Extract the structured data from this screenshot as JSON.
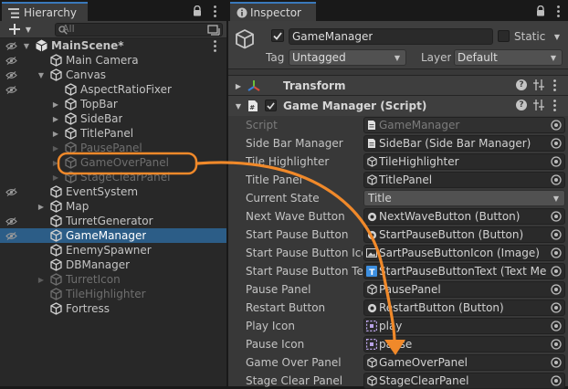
{
  "hierarchy": {
    "tab_title": "Hierarchy",
    "search_placeholder": "All",
    "items": [
      {
        "name": "MainScene*",
        "depth": 0,
        "expanded": true,
        "bold": true,
        "kind": "scene"
      },
      {
        "name": "Main Camera",
        "depth": 1
      },
      {
        "name": "Canvas",
        "depth": 1,
        "expanded": true
      },
      {
        "name": "AspectRatioFixer",
        "depth": 2
      },
      {
        "name": "TopBar",
        "depth": 2,
        "collapsed": true
      },
      {
        "name": "SideBar",
        "depth": 2,
        "collapsed": true
      },
      {
        "name": "TitlePanel",
        "depth": 2,
        "collapsed": true
      },
      {
        "name": "PausePanel",
        "depth": 2,
        "collapsed": true,
        "inactive": true
      },
      {
        "name": "GameOverPanel",
        "depth": 2,
        "collapsed": true,
        "inactive": true
      },
      {
        "name": "StageClearPanel",
        "depth": 2,
        "collapsed": true,
        "inactive": true
      },
      {
        "name": "EventSystem",
        "depth": 1
      },
      {
        "name": "Map",
        "depth": 1,
        "collapsed": true
      },
      {
        "name": "TurretGenerator",
        "depth": 1
      },
      {
        "name": "GameManager",
        "depth": 1,
        "selected": true
      },
      {
        "name": "EnemySpawner",
        "depth": 1
      },
      {
        "name": "DBManager",
        "depth": 1
      },
      {
        "name": "TurretIcon",
        "depth": 1,
        "collapsed": true,
        "inactive": true
      },
      {
        "name": "TileHighlighter",
        "depth": 1,
        "inactive": true
      },
      {
        "name": "Fortress",
        "depth": 1
      }
    ]
  },
  "inspector": {
    "tab_title": "Inspector",
    "object_name": "GameManager",
    "static_label": "Static",
    "tag_label": "Tag",
    "tag_value": "Untagged",
    "layer_label": "Layer",
    "layer_value": "Default",
    "transform_title": "Transform",
    "script_component_title": "Game Manager (Script)",
    "properties": [
      {
        "label": "Script",
        "value": "GameManager",
        "icon": "script-icon",
        "disabled": true
      },
      {
        "label": "Side Bar Manager",
        "value": "SideBar (Side Bar Manager)",
        "icon": "script-icon"
      },
      {
        "label": "Tile Highlighter",
        "value": "TileHighlighter",
        "icon": "gameobject-icon"
      },
      {
        "label": "Title Panel",
        "value": "TitlePanel",
        "icon": "gameobject-icon"
      },
      {
        "label": "Current State",
        "value": "Title",
        "icon": "enum"
      },
      {
        "label": "Next Wave Button",
        "value": "NextWaveButton (Button)",
        "icon": "button-icon"
      },
      {
        "label": "Start Pause Button",
        "value": "StartPauseButton (Button)",
        "icon": "button-icon"
      },
      {
        "label": "Start Pause Button Icon",
        "value": "SartPauseButtonIcon (Image)",
        "icon": "image-icon"
      },
      {
        "label": "Start Pause Button Text",
        "value": "StartPauseButtonText (Text Mesh",
        "icon": "text-icon"
      },
      {
        "label": "Pause Panel",
        "value": "PausePanel",
        "icon": "gameobject-icon"
      },
      {
        "label": "Restart Button",
        "value": "RestartButton (Button)",
        "icon": "button-icon"
      },
      {
        "label": "Play Icon",
        "value": "play",
        "icon": "sprite-icon"
      },
      {
        "label": "Pause Icon",
        "value": "pause",
        "icon": "sprite-icon"
      },
      {
        "label": "Game Over Panel",
        "value": "GameOverPanel",
        "icon": "gameobject-icon"
      },
      {
        "label": "Stage Clear Panel",
        "value": "StageClearPanel",
        "icon": "gameobject-icon"
      }
    ]
  },
  "colors": {
    "selection": "#2c5d87",
    "drag_arrow": "#f0892a",
    "tab_accent": "#3a79bb"
  }
}
